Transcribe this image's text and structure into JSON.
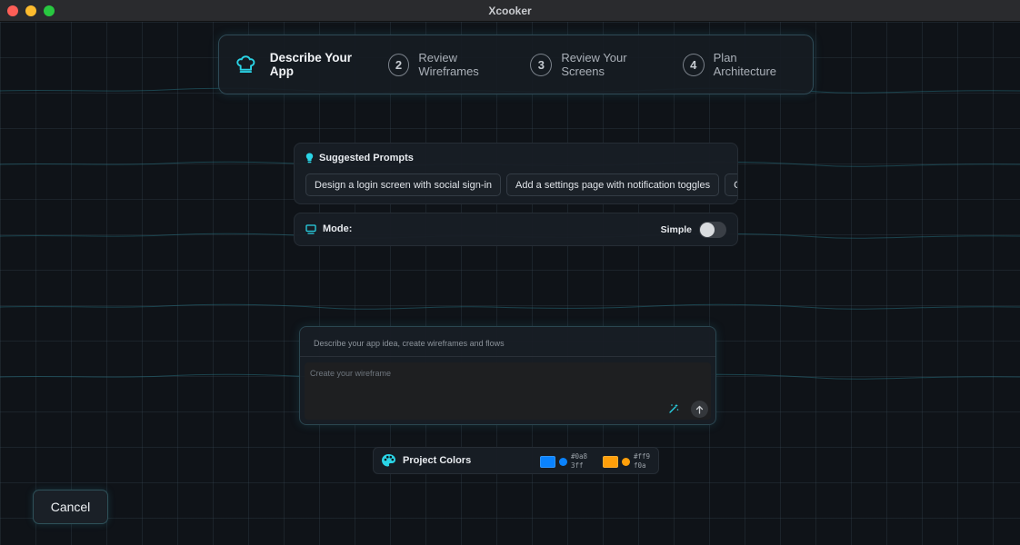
{
  "window": {
    "title": "Xcooker"
  },
  "stepper": {
    "steps": [
      {
        "number": "",
        "label": "Describe Your App",
        "active": true
      },
      {
        "number": "2",
        "label": "Review Wireframes",
        "active": false
      },
      {
        "number": "3",
        "label": "Review Your Screens",
        "active": false
      },
      {
        "number": "4",
        "label": "Plan Architecture",
        "active": false
      }
    ],
    "icon": "chef-hat-icon"
  },
  "suggested": {
    "title": "Suggested Prompts",
    "icon": "lightbulb-icon",
    "prompts": [
      "Design a login screen with social sign-in",
      "Add a settings page with notification toggles",
      "Cr"
    ]
  },
  "mode": {
    "label": "Mode:",
    "icon": "monitor-icon",
    "value": "Simple",
    "enabled": false
  },
  "composer": {
    "hint": "Describe your app idea, create wireframes and flows",
    "placeholder": "Create your wireframe",
    "magic_icon": "magic-wand-icon",
    "send_icon": "arrow-up-icon"
  },
  "project_colors": {
    "title": "Project Colors",
    "icon": "palette-icon",
    "colors": [
      {
        "hex": "#0a83ff",
        "label": "#0a8\n3ff"
      },
      {
        "hex": "#ff9f0a",
        "label": "#ff9\nf0a"
      }
    ]
  },
  "footer": {
    "cancel_label": "Cancel"
  },
  "theme": {
    "accent": "#2ad4e6",
    "background": "#0f1318"
  }
}
